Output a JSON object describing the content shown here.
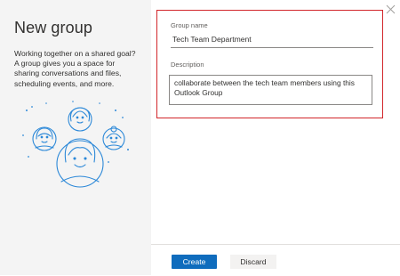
{
  "dialog": {
    "title": "New group",
    "description": "Working together on a shared goal? A group gives you a space for sharing conversations and files, scheduling events, and more."
  },
  "form": {
    "name_label": "Group name",
    "name_value": "Tech Team Department",
    "description_label": "Description",
    "description_value": "collaborate between the tech team members using this Outlook Group"
  },
  "buttons": {
    "create_label": "Create",
    "discard_label": "Discard"
  },
  "icons": {
    "close": "close-icon",
    "illustration": "people-group-illustration"
  },
  "colors": {
    "accent": "#0f6cbd",
    "highlight_border": "#d2262b",
    "illustration_stroke": "#2b88d8"
  }
}
